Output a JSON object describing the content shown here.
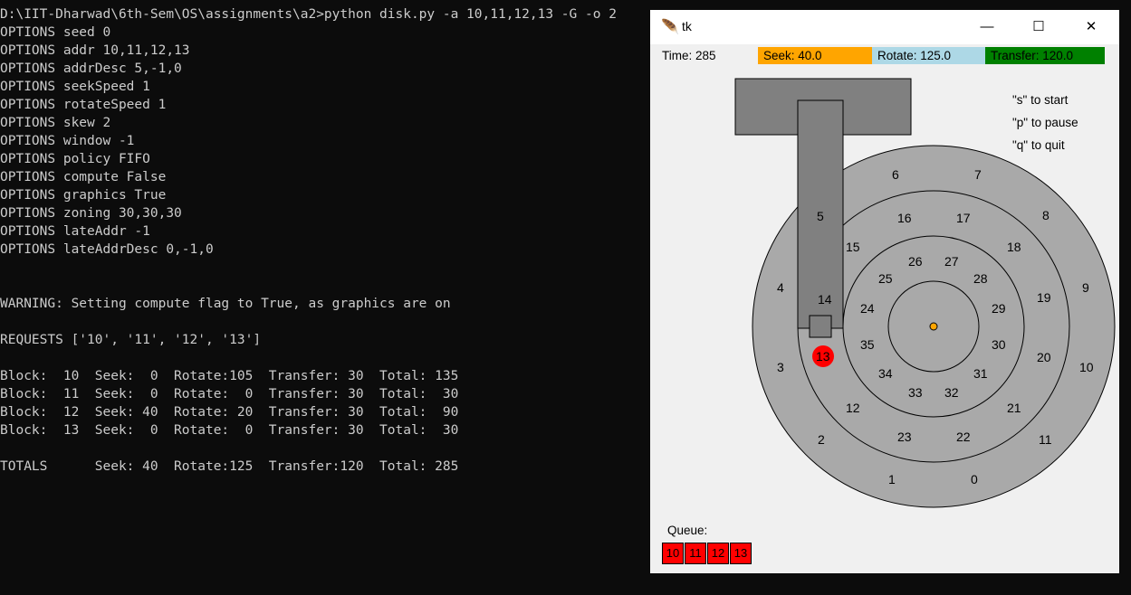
{
  "console": {
    "lines": [
      "D:\\IIT-Dharwad\\6th-Sem\\OS\\assignments\\a2>python disk.py -a 10,11,12,13 -G -o 2",
      "OPTIONS seed 0",
      "OPTIONS addr 10,11,12,13",
      "OPTIONS addrDesc 5,-1,0",
      "OPTIONS seekSpeed 1",
      "OPTIONS rotateSpeed 1",
      "OPTIONS skew 2",
      "OPTIONS window -1",
      "OPTIONS policy FIFO",
      "OPTIONS compute False",
      "OPTIONS graphics True",
      "OPTIONS zoning 30,30,30",
      "OPTIONS lateAddr -1",
      "OPTIONS lateAddrDesc 0,-1,0",
      "",
      "",
      "WARNING: Setting compute flag to True, as graphics are on",
      "",
      "REQUESTS ['10', '11', '12', '13']",
      "",
      "Block:  10  Seek:  0  Rotate:105  Transfer: 30  Total: 135",
      "Block:  11  Seek:  0  Rotate:  0  Transfer: 30  Total:  30",
      "Block:  12  Seek: 40  Rotate: 20  Transfer: 30  Total:  90",
      "Block:  13  Seek:  0  Rotate:  0  Transfer: 30  Total:  30",
      "",
      "TOTALS      Seek: 40  Rotate:125  Transfer:120  Total: 285"
    ]
  },
  "window": {
    "title": "tk",
    "icon": "feather-icon",
    "minimize_glyph": "—",
    "maximize_glyph": "☐",
    "close_glyph": "✕"
  },
  "stats": {
    "time_label": "Time: 285",
    "seek_label": "Seek: 40.0",
    "rotate_label": "Rotate: 125.0",
    "transfer_label": "Transfer: 120.0",
    "seek_color": "#ffa500",
    "rotate_color": "#add8e6",
    "transfer_color": "#008000"
  },
  "help": {
    "start": "\"s\" to start",
    "pause": "\"p\" to pause",
    "quit": "\"q\" to quit"
  },
  "disk": {
    "outer_track": [
      "6",
      "7",
      "8",
      "9",
      "10",
      "11",
      "0",
      "1",
      "2",
      "3",
      "4",
      "5"
    ],
    "middle_track": [
      "16",
      "17",
      "18",
      "19",
      "20",
      "21",
      "22",
      "23",
      "12",
      "14",
      "15"
    ],
    "inner_track": [
      "26",
      "27",
      "28",
      "29",
      "30",
      "31",
      "32",
      "33",
      "34",
      "35",
      "24",
      "25"
    ],
    "highlighted_block": "13",
    "highlight_color": "#ff0000",
    "platter_color": "#a9a9a9",
    "arm_color": "#808080",
    "spindle_color": "#ffa500"
  },
  "queue": {
    "label": "Queue:",
    "items": [
      "10",
      "11",
      "12",
      "13"
    ],
    "item_color": "#ff0000"
  }
}
